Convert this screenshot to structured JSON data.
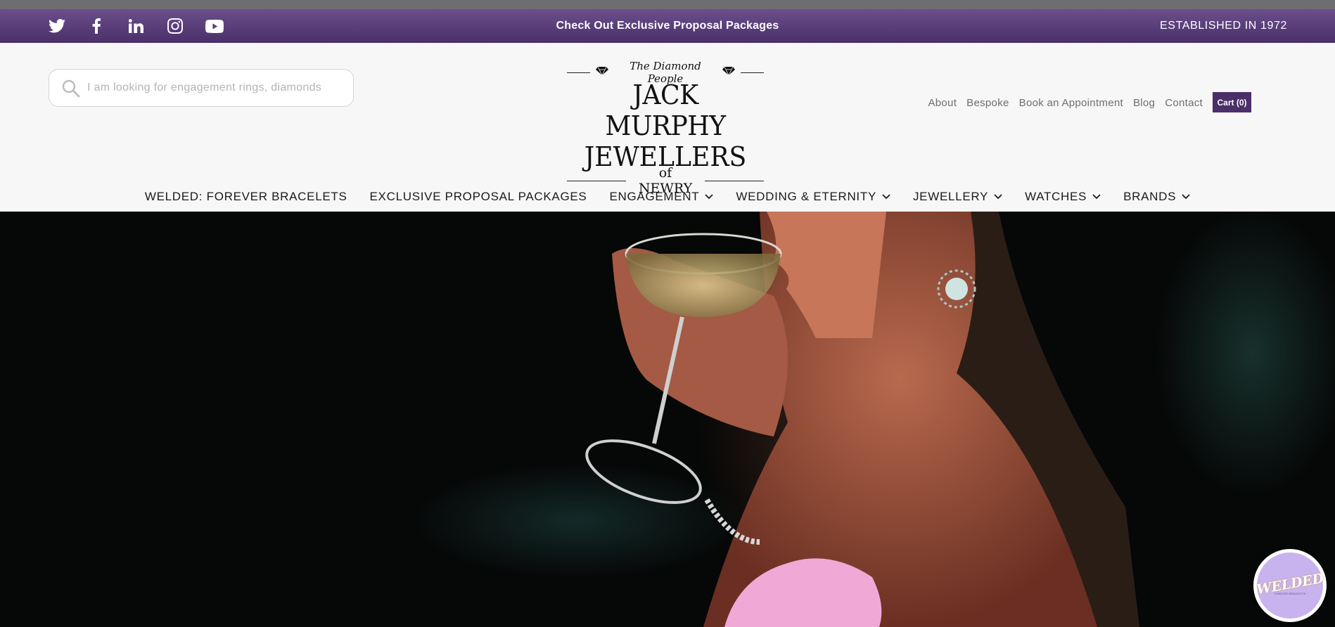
{
  "topbar": {
    "social": [
      "twitter-icon",
      "facebook-icon",
      "linkedin-icon",
      "instagram-icon",
      "youtube-icon"
    ],
    "promo": "Check Out Exclusive Proposal Packages",
    "established": "ESTABLISHED IN 1972"
  },
  "search": {
    "placeholder": "I am looking for engagement rings, diamonds"
  },
  "logo": {
    "tagline": "The Diamond People",
    "line1": "JACK MURPHY",
    "line2": "JEWELLERS",
    "line3": "of NEWRY"
  },
  "util_nav": {
    "about": "About",
    "bespoke": "Bespoke",
    "book": "Book an Appointment",
    "blog": "Blog",
    "contact": "Contact",
    "cart": "Cart (0)"
  },
  "main_nav": {
    "welded": "WELDED: FOREVER BRACELETS",
    "proposal": "EXCLUSIVE PROPOSAL PACKAGES",
    "engagement": "ENGAGEMENT",
    "wedding": "WEDDING & ETERNITY",
    "jewellery": "JEWELLERY",
    "watches": "WATCHES",
    "brands": "BRANDS"
  },
  "badge": {
    "title": "WELDED",
    "subtitle": "FOREVER BRACELETS"
  },
  "colors": {
    "brand_purple": "#4a2f69",
    "topbar_gradient_top": "#6b4f8c",
    "badge_lilac": "#c9b3ee"
  }
}
